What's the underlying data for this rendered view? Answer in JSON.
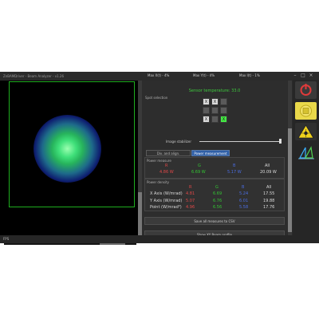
{
  "window": {
    "title": "ZnBAMDriver - Beam Analyzer - v1.26",
    "stats": [
      {
        "label": "Max X(t) - ",
        "value": "4%"
      },
      {
        "label": "Max Y(t) - ",
        "value": "4%"
      },
      {
        "label": "Max I(t) - ",
        "value": "1%"
      }
    ]
  },
  "panel": {
    "sensor_temperature": "Sensor temperature: 33.0",
    "spot_selection_title": "Spot selection",
    "spot_grid": [
      [
        "X",
        "X",
        ""
      ],
      [
        "",
        "",
        ""
      ],
      [
        "X",
        "",
        "X"
      ]
    ],
    "image_stabilizer_label": "Image stabilizer",
    "tabs": [
      {
        "label": "Div. and align. measurement",
        "active": false
      },
      {
        "label": "Power measurement",
        "active": true
      }
    ],
    "power_measure": {
      "title": "Power measure",
      "headers": [
        "R",
        "G",
        "B",
        "All"
      ],
      "values": [
        "4.86 W",
        "6.69 W",
        "5.17 W",
        "20.09 W"
      ]
    },
    "power_density": {
      "title": "Power density",
      "headers": [
        "R",
        "G",
        "B",
        "All"
      ],
      "rows": [
        {
          "label": "X Axis (W/mrad)",
          "values": [
            "4.81",
            "6.69",
            "5.24",
            "17.55"
          ]
        },
        {
          "label": "Y Axis (W/mrad)",
          "values": [
            "5.07",
            "6.76",
            "6.01",
            "19.88"
          ]
        },
        {
          "label": "Point (W/mrad²)",
          "values": [
            "4.96",
            "6.56",
            "5.58",
            "17.76"
          ]
        }
      ]
    },
    "buttons": {
      "save_csv": "Save all measures to CSV",
      "show_profile": "Show XY Beam profile"
    }
  },
  "status": {
    "text": "FPS"
  },
  "colors": {
    "accent_green": "#3ecb3e",
    "red": "#e04848",
    "green": "#33c533",
    "blue": "#4a6ce0",
    "tab_active": "#2f5fa7"
  },
  "icons": [
    "power-icon",
    "stop-icon",
    "laser-warning-icon",
    "logo-icon",
    "minimize-icon",
    "maximize-icon",
    "close-icon"
  ]
}
